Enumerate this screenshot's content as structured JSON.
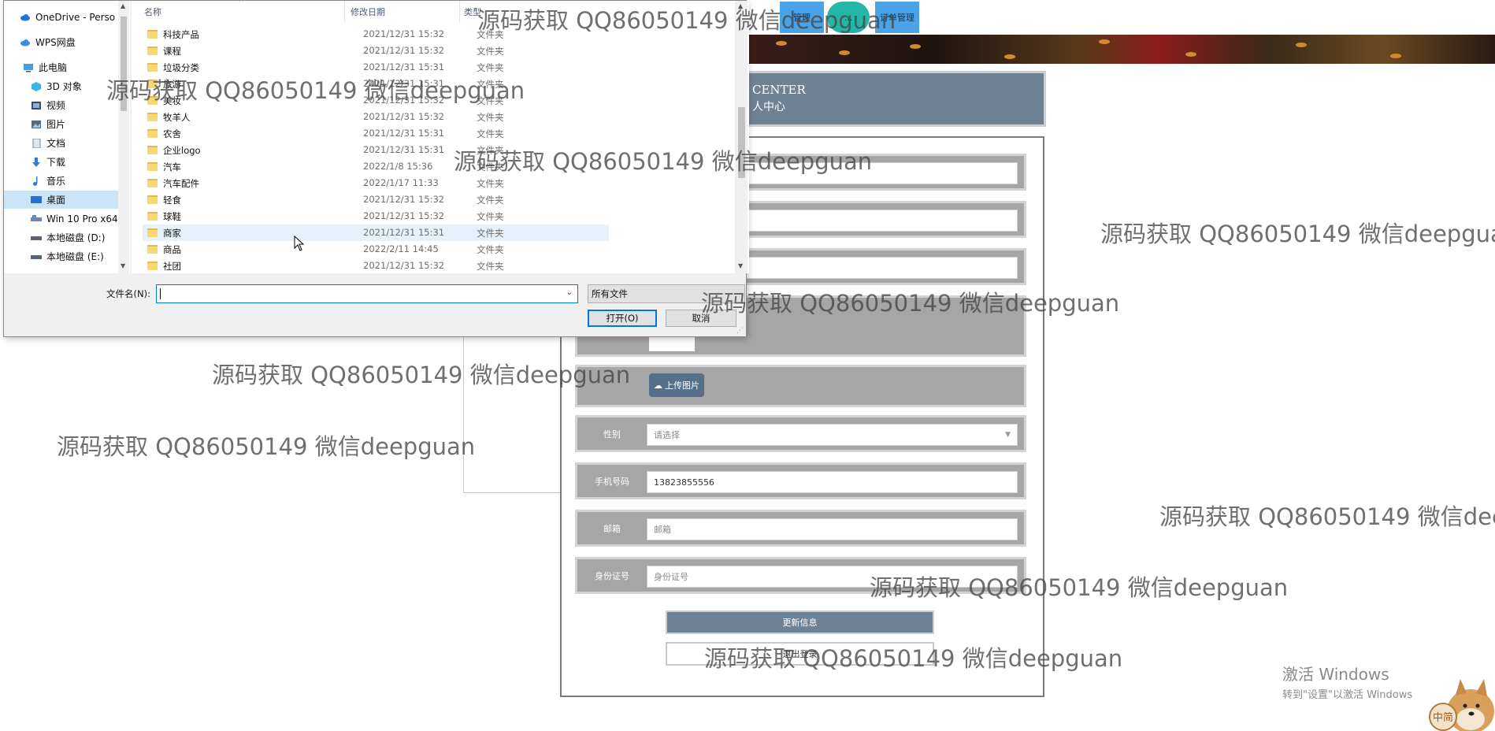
{
  "background_page": {
    "nav_buttons": [
      "管理",
      "...",
      "订单管理"
    ],
    "center": {
      "title_en": "CENTER",
      "title_cn": "人中心"
    },
    "form": {
      "upload_label": "上传图片",
      "gender_label": "性别",
      "gender_placeholder": "请选择",
      "phone_label": "手机号码",
      "phone_value": "13823855556",
      "email_label": "邮箱",
      "email_placeholder": "邮箱",
      "id_label": "身份证号",
      "id_placeholder": "身份证号",
      "update_button": "更新信息",
      "logout_button": "退出登录"
    }
  },
  "file_dialog": {
    "nav_items": [
      {
        "label": "OneDrive - Perso",
        "icon": "cloud-icon"
      },
      {
        "label": "WPS网盘",
        "icon": "cloud-icon"
      },
      {
        "label": "此电脑",
        "icon": "computer-icon"
      },
      {
        "label": "3D 对象",
        "icon": "cube-icon"
      },
      {
        "label": "视频",
        "icon": "video-icon"
      },
      {
        "label": "图片",
        "icon": "image-icon"
      },
      {
        "label": "文档",
        "icon": "document-icon"
      },
      {
        "label": "下载",
        "icon": "download-icon"
      },
      {
        "label": "音乐",
        "icon": "music-icon"
      },
      {
        "label": "桌面",
        "icon": "desktop-icon"
      },
      {
        "label": "Win 10 Pro x64",
        "icon": "drive-icon"
      },
      {
        "label": "本地磁盘 (D:)",
        "icon": "drive-icon"
      },
      {
        "label": "本地磁盘 (E:)",
        "icon": "drive-icon"
      }
    ],
    "selected_nav": "桌面",
    "columns": {
      "name": "名称",
      "modified": "修改日期",
      "type": "类型"
    },
    "files": [
      {
        "name": "科技产品",
        "date": "2021/12/31 15:32",
        "type": "文件夹"
      },
      {
        "name": "课程",
        "date": "2021/12/31 15:32",
        "type": "文件夹"
      },
      {
        "name": "垃圾分类",
        "date": "2021/12/31 15:31",
        "type": "文件夹"
      },
      {
        "name": "旅游",
        "date": "2021/12/31 15:31",
        "type": "文件夹"
      },
      {
        "name": "美妆",
        "date": "2021/12/31 15:32",
        "type": "文件夹"
      },
      {
        "name": "牧羊人",
        "date": "2021/12/31 15:32",
        "type": "文件夹"
      },
      {
        "name": "农舍",
        "date": "2021/12/31 15:31",
        "type": "文件夹"
      },
      {
        "name": "企业logo",
        "date": "2021/12/31 15:31",
        "type": "文件夹"
      },
      {
        "name": "汽车",
        "date": "2022/1/8 15:36",
        "type": "文件夹"
      },
      {
        "name": "汽车配件",
        "date": "2022/1/17 11:33",
        "type": "文件夹"
      },
      {
        "name": "轻食",
        "date": "2021/12/31 15:32",
        "type": "文件夹"
      },
      {
        "name": "球鞋",
        "date": "2021/12/31 15:32",
        "type": "文件夹"
      },
      {
        "name": "商家",
        "date": "2021/12/31 15:31",
        "type": "文件夹"
      },
      {
        "name": "商品",
        "date": "2022/2/11 14:45",
        "type": "文件夹"
      },
      {
        "name": "社团",
        "date": "2021/12/31 15:32",
        "type": "文件夹"
      }
    ],
    "selected_file": "商家",
    "filename_label": "文件名(N):",
    "filename_value": "",
    "filter": "所有文件",
    "open_button": "打开(O)",
    "cancel_button": "取消"
  },
  "watermark_text": "源码获取 QQ86050149 微信deepguan",
  "activate_windows": {
    "line1": "激活 Windows",
    "line2": "转到\"设置\"以激活 Windows"
  },
  "mascot_text": "中简"
}
